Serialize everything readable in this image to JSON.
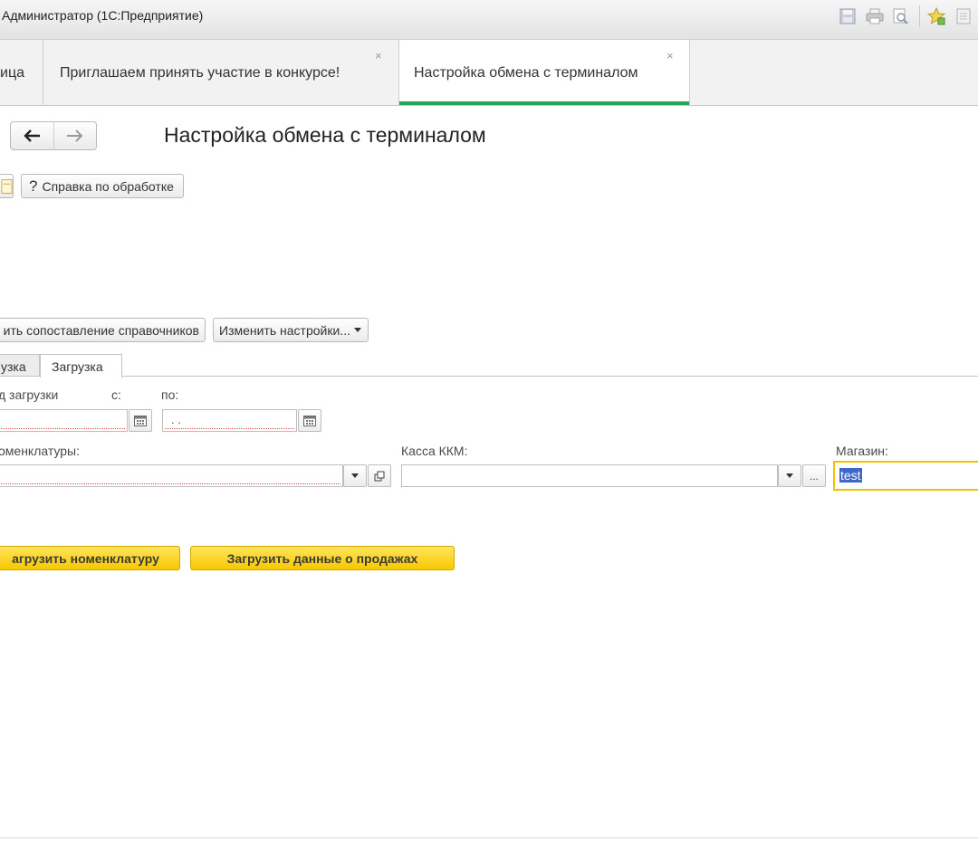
{
  "window": {
    "title": "Администратор  (1С:Предприятие)",
    "toolbar_icons": [
      "save-icon",
      "print-icon",
      "preview-icon",
      "favorites-icon",
      "info-icon"
    ]
  },
  "tabs": [
    {
      "label": "ица",
      "closable": false,
      "active": false
    },
    {
      "label": "Приглашаем принять участие в конкурсе!",
      "close": "×",
      "active": false
    },
    {
      "label": "Настройка обмена с терминалом",
      "close": "×",
      "active": true
    }
  ],
  "colors": {
    "active_tab_accent": "#26a65b",
    "primary_button": "#f7c800",
    "focus_border": "#f2c200",
    "selection": "#3d68c9"
  },
  "form": {
    "title": "Настройка обмена с терминалом",
    "help_button": "Справка по обработке",
    "help_glyph": "?",
    "mapping_button": "ить сопоставление справочников",
    "settings_button": "Изменить настройки...",
    "inner_tabs": [
      "узка",
      "Загрузка"
    ],
    "period_label": "д загрузки",
    "from_label": "с:",
    "to_label": "по:",
    "to_value": " .  .",
    "nomenclature_label": "оменклатуры:",
    "kkm_label": "Касса ККМ:",
    "kkm_more": "...",
    "store_label": "Магазин:",
    "store_value": "test",
    "load_nomenclature_button": "агрузить номенклатуру",
    "load_sales_button": "Загрузить данные о продажах"
  }
}
